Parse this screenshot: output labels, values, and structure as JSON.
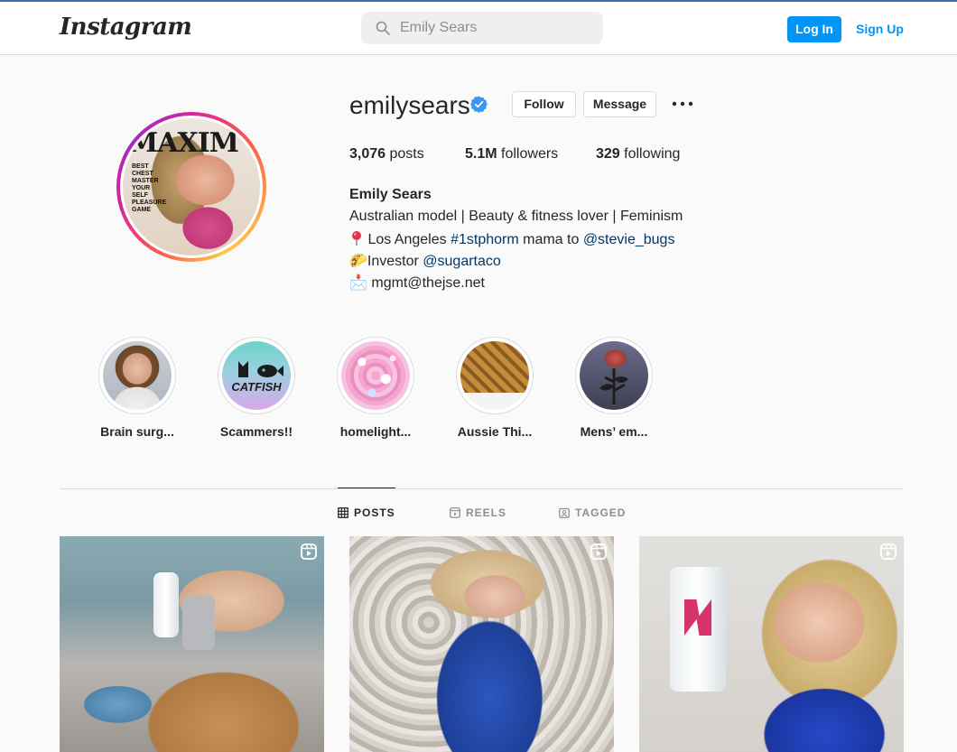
{
  "nav": {
    "logo": "Instagram",
    "search_value": "Emily Sears",
    "login_label": "Log In",
    "signup_label": "Sign Up"
  },
  "profile": {
    "username": "emilysears",
    "verified": true,
    "follow_label": "Follow",
    "message_label": "Message",
    "stats": {
      "posts_count": "3,076",
      "posts_label": "posts",
      "followers_count": "5.1M",
      "followers_label": "followers",
      "following_count": "329",
      "following_label": "following"
    },
    "full_name": "Emily Sears",
    "bio": {
      "line1": "Australian model | Beauty & fitness lover | Feminism",
      "line2_pre": " Los Angeles ",
      "line2_hashtag": "#1stphorm",
      "line2_mid": " mama to ",
      "line2_mention": "@stevie_bugs",
      "line3_emoji": "🌮",
      "line3_pre": "Investor ",
      "line3_mention": "@sugartaco",
      "line4_emoji": "📩",
      "line4_text": " mgmt@thejse.net"
    },
    "avatar_cover": {
      "mag_title": "MAXIM",
      "cover_lines": "BEST CHEST MASTER YOUR SELF PLEASURE GAME"
    }
  },
  "highlights": [
    {
      "label": "Brain surg..."
    },
    {
      "label": "Scammers!!",
      "badge_text": "CATFISH"
    },
    {
      "label": "homelight..."
    },
    {
      "label": "Aussie Thi..."
    },
    {
      "label": "Mens’ em..."
    }
  ],
  "tabs": [
    {
      "label": "POSTS",
      "icon": "grid-icon",
      "active": true
    },
    {
      "label": "REELS",
      "icon": "reels-icon",
      "active": false
    },
    {
      "label": "TAGGED",
      "icon": "tagged-icon",
      "active": false
    }
  ],
  "posts": [
    {
      "type": "reel",
      "icon": "reel-icon"
    },
    {
      "type": "reel",
      "icon": "reel-icon"
    },
    {
      "type": "reel",
      "icon": "reel-icon"
    }
  ],
  "colors": {
    "accent": "#0095f6",
    "link": "#00376b",
    "verified": "#3897f0",
    "background": "#fafafa"
  }
}
